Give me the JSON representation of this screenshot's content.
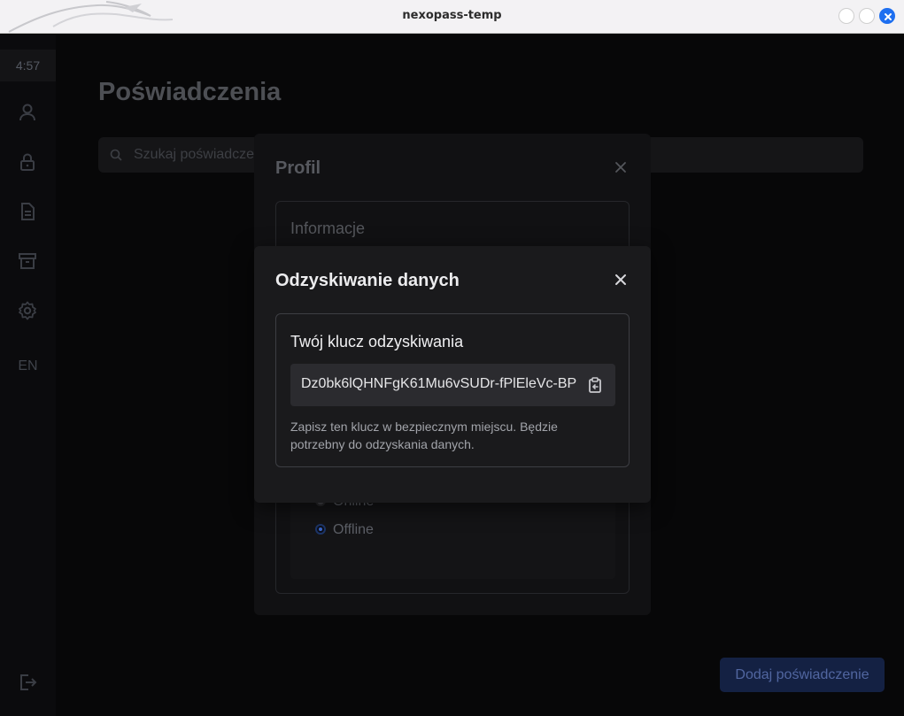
{
  "window": {
    "title": "nexopass-temp"
  },
  "sidebar": {
    "timer": "4:57",
    "icons": [
      "user-icon",
      "lock-icon",
      "document-icon",
      "archive-icon",
      "gear-icon"
    ],
    "language": "EN",
    "logout_icon": "logout-icon"
  },
  "main": {
    "title": "Poświadczenia",
    "search_placeholder": "Szukaj poświadcze",
    "add_button": "Dodaj poświadczenie"
  },
  "profile_modal": {
    "title": "Profil",
    "section_title": "Informacje",
    "mode_options": [
      {
        "label": "Online",
        "selected": false
      },
      {
        "label": "Offline",
        "selected": true
      }
    ]
  },
  "recovery_modal": {
    "title": "Odzyskiwanie danych",
    "key_heading": "Twój klucz odzyskiwania",
    "key_value": "Dz0bk6lQHNFgK61Mu6vSUDr-fPlEleVc-BP",
    "note": "Zapisz ten klucz w bezpiecznym miejscu. Będzie potrzebny do odzyskania danych."
  },
  "colors": {
    "accent": "#1e6ff0",
    "primary_button_dim": "#142143",
    "modal_bg": "#1a1a1c"
  }
}
